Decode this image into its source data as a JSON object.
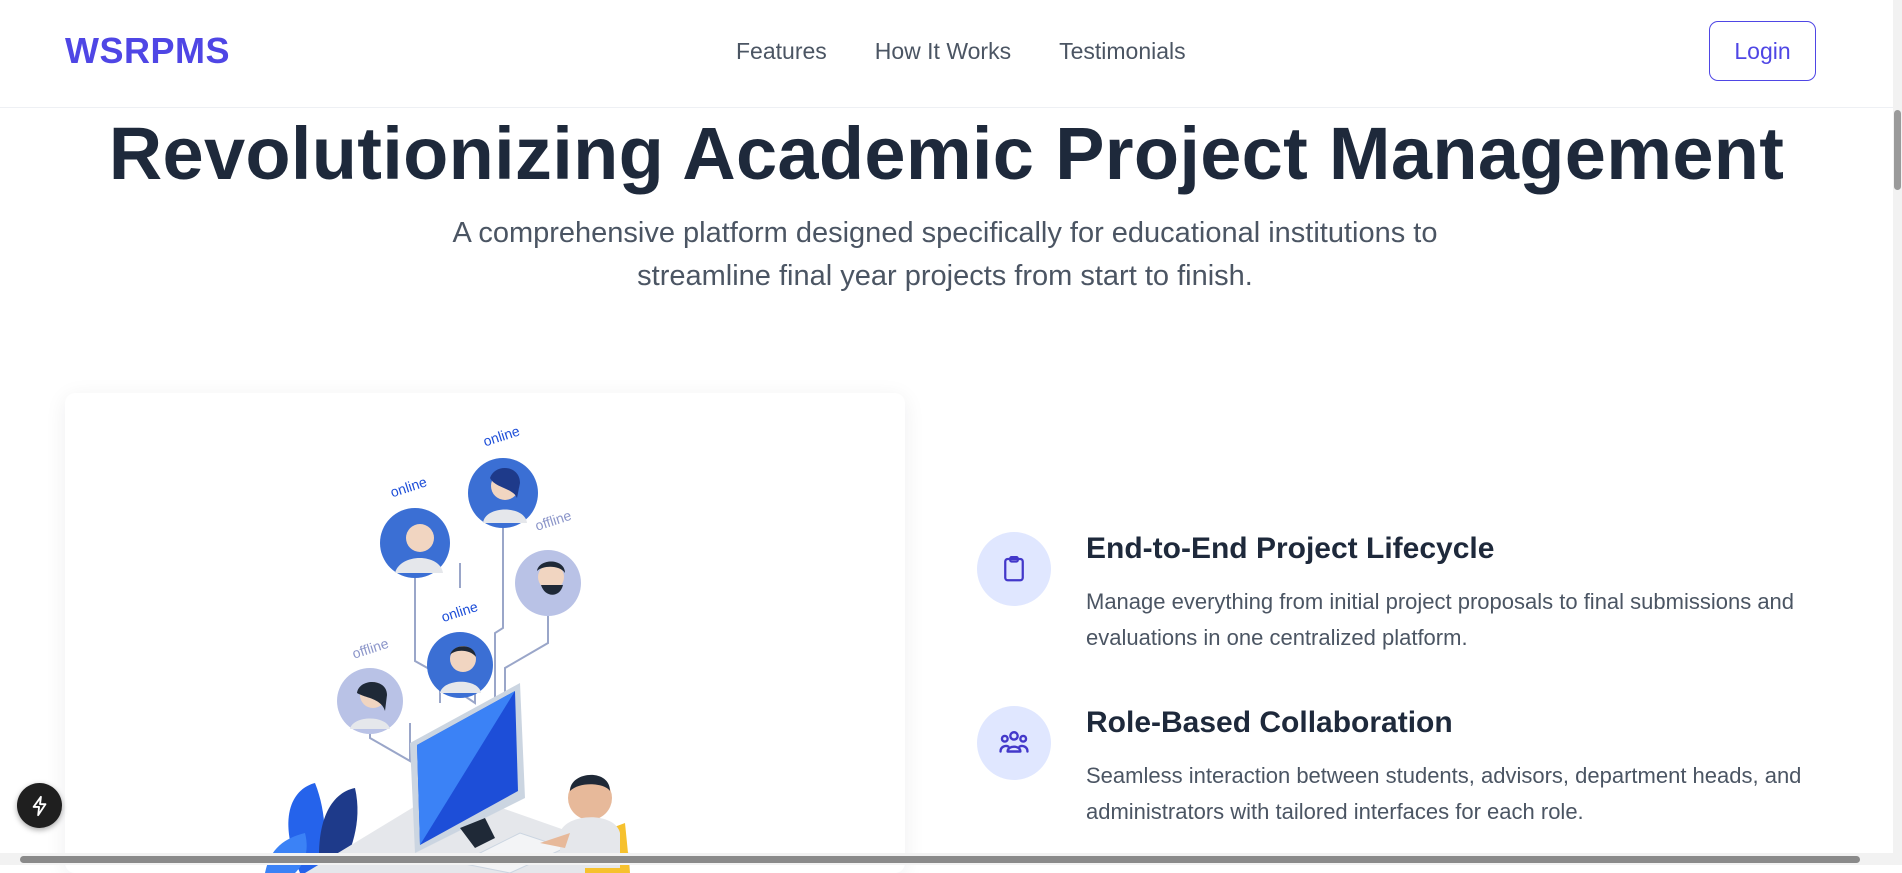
{
  "brand": {
    "logo": "WSRPMS",
    "accent": "#4f46e5"
  },
  "nav": {
    "items": [
      "Features",
      "How It Works",
      "Testimonials"
    ],
    "login_label": "Login"
  },
  "hero": {
    "title": "Revolutionizing Academic Project Management",
    "subtitle": "A comprehensive platform designed specifically for educational institutions to streamline final year projects from start to finish."
  },
  "illustration": {
    "status_labels": [
      "online",
      "online",
      "offline",
      "online",
      "offline"
    ],
    "description_icon": "network-of-users-illustration"
  },
  "features": [
    {
      "icon": "clipboard-icon",
      "title": "End-to-End Project Lifecycle",
      "description": "Manage everything from initial project proposals to final submissions and evaluations in one centralized platform."
    },
    {
      "icon": "users-group-icon",
      "title": "Role-Based Collaboration",
      "description": "Seamless interaction between students, advisors, department heads, and administrators with tailored interfaces for each role."
    }
  ],
  "colors": {
    "heading": "#1e293b",
    "body_text": "#4b5563",
    "icon_bg": "#e0e7ff"
  }
}
